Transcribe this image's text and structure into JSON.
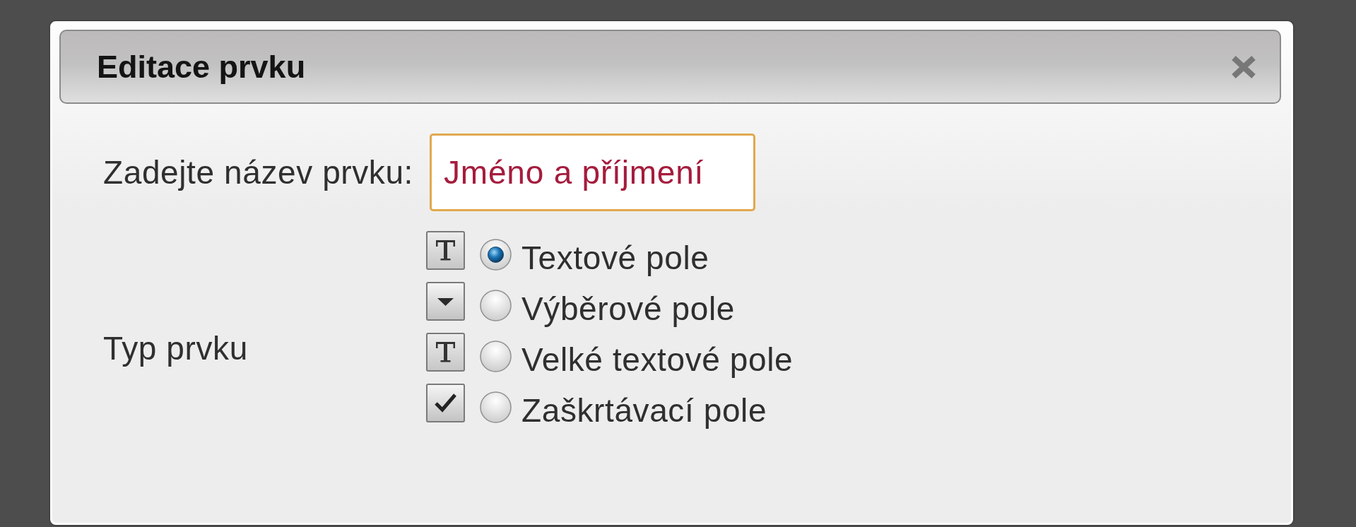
{
  "dialog": {
    "title": "Editace prvku"
  },
  "name_field": {
    "label": "Zadejte název prvku:",
    "value": "Jméno a příjmení",
    "focused": true
  },
  "type_field": {
    "label": "Typ prvku",
    "options": [
      {
        "kind": "text",
        "label": "Textové pole",
        "selected": true
      },
      {
        "kind": "select",
        "label": "Výběrové pole",
        "selected": false
      },
      {
        "kind": "textarea",
        "label": "Velké textové pole",
        "selected": false
      },
      {
        "kind": "checkbox",
        "label": "Zaškrtávací pole",
        "selected": false
      }
    ]
  }
}
